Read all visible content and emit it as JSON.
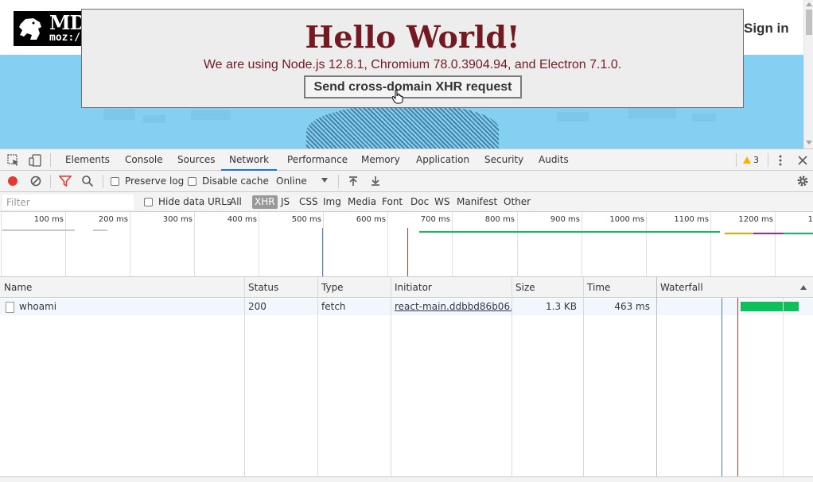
{
  "page": {
    "logo_line1": "MDN",
    "logo_line2": "moz://a",
    "sign_in": "Sign in"
  },
  "popup": {
    "title": "Hello World!",
    "versions": "We are using Node.js 12.8.1, Chromium 78.0.3904.94, and Electron 7.1.0.",
    "xhr_button": "Send cross-domain XHR request"
  },
  "devtools": {
    "tabs": [
      "Elements",
      "Console",
      "Sources",
      "Network",
      "Performance",
      "Memory",
      "Application",
      "Security",
      "Audits"
    ],
    "active_tab": "Network",
    "warning_count": "3",
    "toolbar": {
      "preserve_log": "Preserve log",
      "disable_cache": "Disable cache",
      "throttling": "Online"
    },
    "filter": {
      "placeholder": "Filter",
      "hide_data_urls": "Hide data URLs",
      "types": [
        "All",
        "XHR",
        "JS",
        "CSS",
        "Img",
        "Media",
        "Font",
        "Doc",
        "WS",
        "Manifest",
        "Other"
      ],
      "selected_type": "XHR"
    },
    "overview": {
      "ticks": [
        "100 ms",
        "200 ms",
        "300 ms",
        "400 ms",
        "500 ms",
        "600 ms",
        "700 ms",
        "800 ms",
        "900 ms",
        "1000 ms",
        "1100 ms",
        "1200 ms",
        "1"
      ]
    },
    "table": {
      "columns": [
        "Name",
        "Status",
        "Type",
        "Initiator",
        "Size",
        "Time",
        "Waterfall"
      ],
      "rows": [
        {
          "name": "whoami",
          "status": "200",
          "type": "fetch",
          "initiator": "react-main.ddbbd86b06…",
          "size": "1.3 KB",
          "time": "463 ms"
        }
      ]
    },
    "colors": {
      "record": "#e53935",
      "filter_active": "#e53935",
      "waterfall_bar": "#0fbf5a",
      "dom_content_loaded": "#4a7fd4",
      "load_event": "#c0392b"
    }
  }
}
